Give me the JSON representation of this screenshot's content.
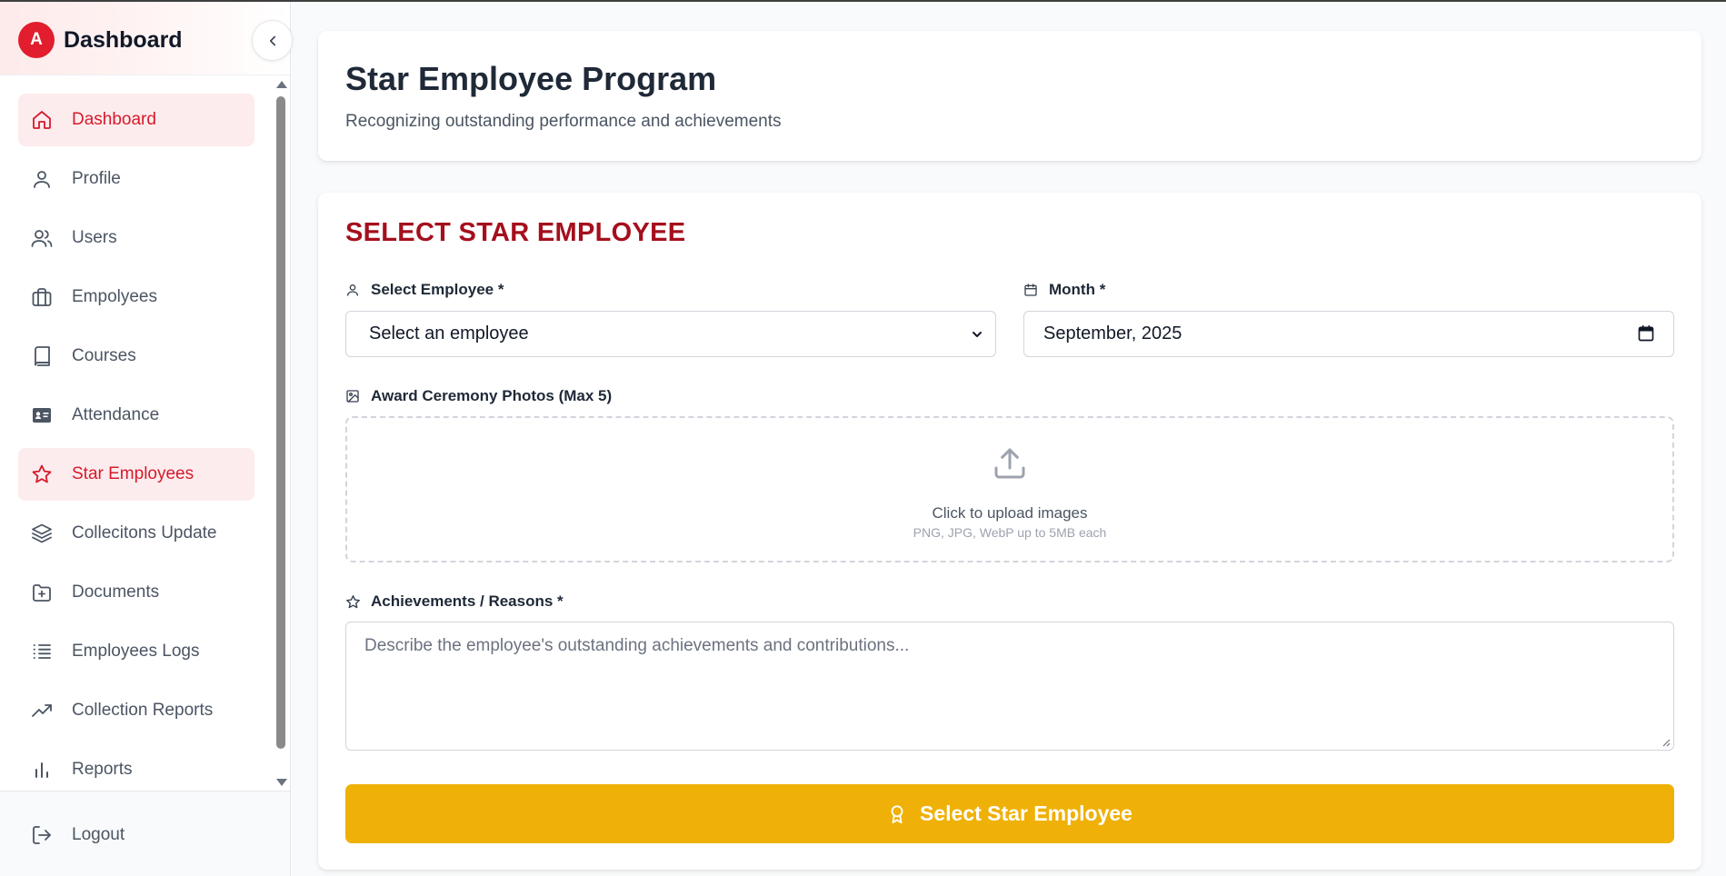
{
  "sidebar": {
    "logo_letter": "A",
    "title": "Dashboard",
    "items": [
      {
        "label": "Dashboard",
        "icon": "home-icon",
        "active": true
      },
      {
        "label": "Profile",
        "icon": "user-icon"
      },
      {
        "label": "Users",
        "icon": "users-icon"
      },
      {
        "label": "Empolyees",
        "icon": "briefcase-icon"
      },
      {
        "label": "Courses",
        "icon": "book-icon"
      },
      {
        "label": "Attendance",
        "icon": "id-card-icon"
      },
      {
        "label": "Star Employees",
        "icon": "star-icon",
        "active": true
      },
      {
        "label": "Collecitons Update",
        "icon": "layers-icon"
      },
      {
        "label": "Documents",
        "icon": "folder-plus-icon"
      },
      {
        "label": "Employees Logs",
        "icon": "list-icon"
      },
      {
        "label": "Collection Reports",
        "icon": "trending-up-icon"
      },
      {
        "label": "Reports",
        "icon": "bar-chart-icon"
      }
    ],
    "logout_label": "Logout"
  },
  "header": {
    "title": "Star Employee Program",
    "subtitle": "Recognizing outstanding performance and achievements"
  },
  "form": {
    "section_title": "SELECT STAR EMPLOYEE",
    "employee_label": "Select Employee *",
    "employee_value": "Select an employee",
    "month_label": "Month *",
    "month_value": "September, 2025",
    "photos_label": "Award Ceremony Photos (Max 5)",
    "upload_text": "Click to upload images",
    "upload_hint": "PNG, JPG, WebP up to 5MB each",
    "achievements_label": "Achievements / Reasons *",
    "achievements_placeholder": "Describe the employee's outstanding achievements and contributions...",
    "submit_label": "Select Star Employee"
  },
  "colors": {
    "accent_red": "#d61a2c",
    "section_red": "#a50f1c",
    "button_yellow": "#efb008",
    "active_bg": "#fdeced"
  }
}
